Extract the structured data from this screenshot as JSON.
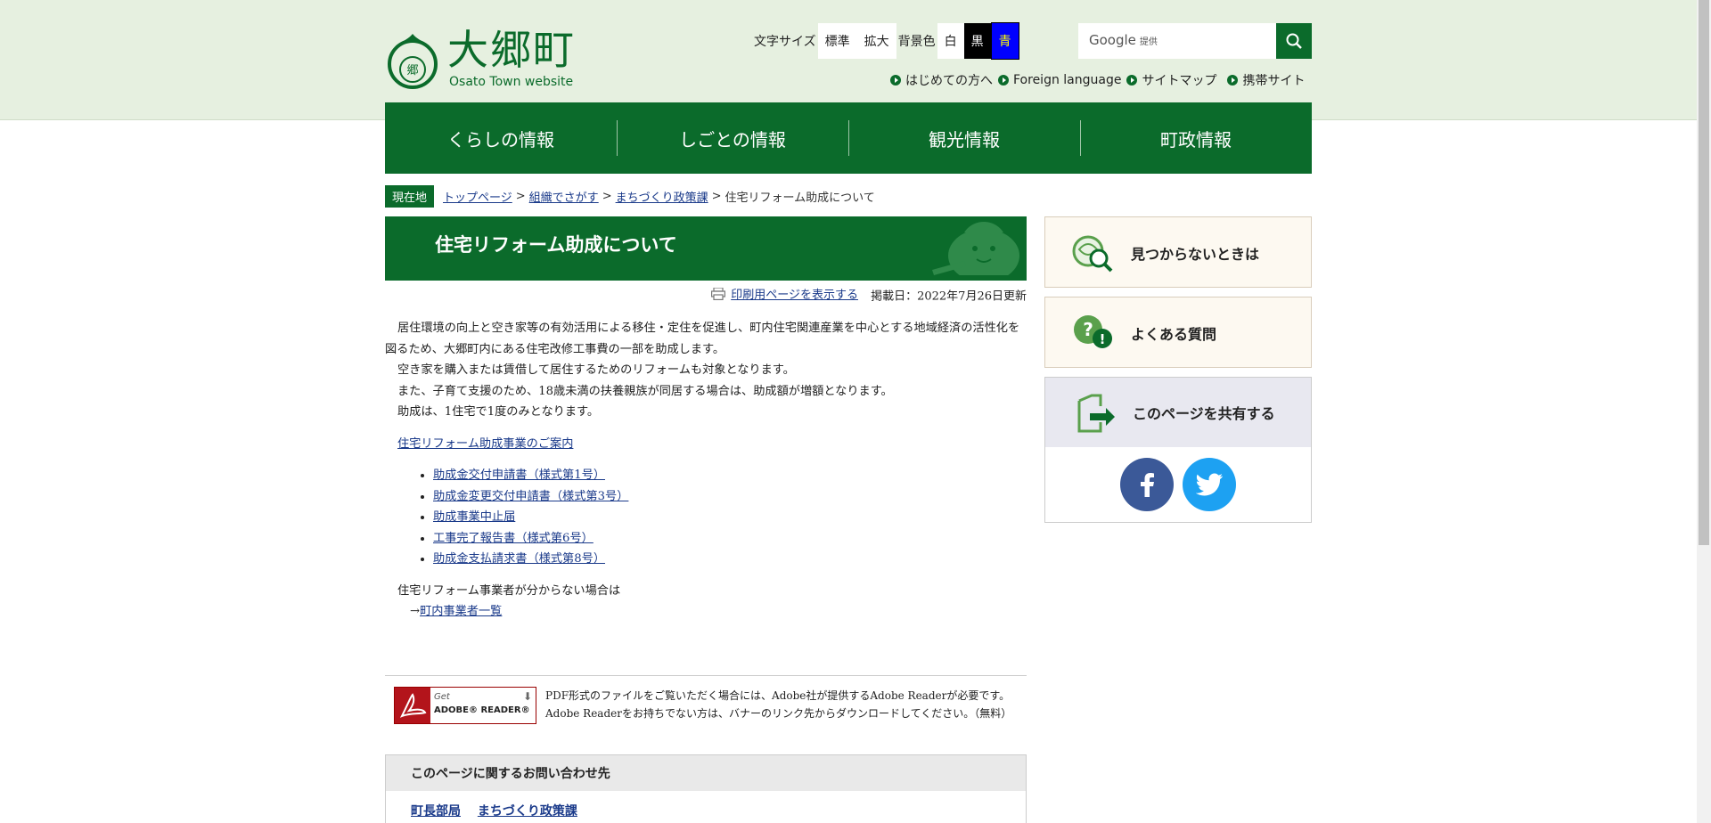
{
  "header": {
    "logo_text": "大郷町",
    "logo_sub": "Osato Town website",
    "font_size_label": "文字サイズ",
    "font_standard": "標準",
    "font_large": "拡大",
    "bg_color_label": "背景色",
    "bg_white": "白",
    "bg_black": "黒",
    "bg_blue": "青",
    "search_placeholder": "Google",
    "search_provider": "提供",
    "links": [
      "はじめての方へ",
      "Foreign language",
      "サイトマップ",
      "携帯サイト"
    ]
  },
  "nav": [
    "くらしの情報",
    "しごとの情報",
    "観光情報",
    "町政情報"
  ],
  "breadcrumb": {
    "label": "現在地",
    "items": [
      "トップページ",
      "組織でさがす",
      "まちづくり政策課"
    ],
    "current": "住宅リフォーム助成について"
  },
  "page": {
    "title": "住宅リフォーム助成について",
    "print_link": "印刷用ページを表示する",
    "posted": "掲載日：2022年7月26日更新",
    "paragraphs": [
      "居住環境の向上と空き家等の有効活用による移住・定住を促進し、町内住宅関連産業を中心とする地域経済の活性化を図るため、大郷町内にある住宅改修工事費の一部を助成します。",
      "空き家を購入または賃借して居住するためのリフォームも対象となります。",
      "また、子育て支援のため、18歳未満の扶養親族が同居する場合は、助成額が増額となります。",
      "助成は、1住宅で1度のみとなります。"
    ],
    "guide_link": "住宅リフォーム助成事業のご案内",
    "forms": [
      "助成金交付申請書（様式第1号）",
      "助成金変更交付申請書（様式第3号）",
      "助成事業中止届",
      "工事完了報告書（様式第6号）",
      "助成金支払請求書（様式第8号）"
    ],
    "after_text": "住宅リフォーム事業者が分からない場合は",
    "arrow": "→",
    "company_link": "町内事業者一覧"
  },
  "adobe": {
    "badge_get": "Get",
    "badge_name": "ADOBE® READER®",
    "text": "PDF形式のファイルをご覧いただく場合には、Adobe社が提供するAdobe Readerが必要です。Adobe Readerをお持ちでない方は、バナーのリンク先からダウンロードしてください。（無料）"
  },
  "contact": {
    "heading": "このページに関するお問い合わせ先",
    "dept1": "町長部局",
    "dept2": "まちづくり政策課"
  },
  "side": {
    "not_found": "見つからないときは",
    "faq": "よくある質問",
    "share": "このページを共有する"
  },
  "colors": {
    "brand_green": "#0b6b2b",
    "header_bg": "#e6f0e0",
    "facebook": "#3b5998",
    "twitter": "#1da1f2"
  }
}
